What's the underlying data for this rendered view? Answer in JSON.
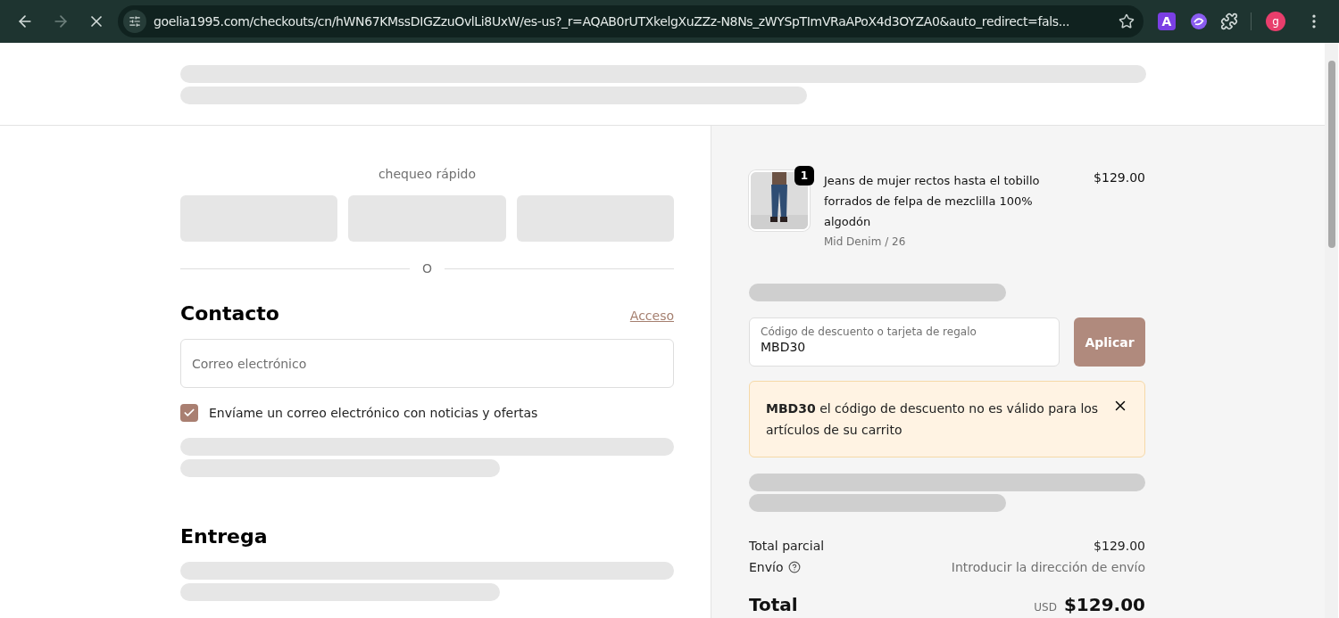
{
  "browser": {
    "url": "goelia1995.com/checkouts/cn/hWN67KMssDIGZzuOvlLi8UxW/es-us?_r=AQAB0rUTXkelgXuZZz-N8Ns_zWYSpTImVRaAPoX4d3OYZA0&auto_redirect=fals...",
    "loading": true,
    "extension_letter": "A",
    "profile_letter": "g"
  },
  "express": {
    "title": "chequeo rápido",
    "separator": "O"
  },
  "contact": {
    "heading": "Contacto",
    "login_link": "Acceso",
    "email": {
      "placeholder": "Correo electrónico"
    },
    "newsletter": {
      "label": "Envíame un correo electrónico con noticias y ofertas",
      "checked": true
    }
  },
  "delivery": {
    "heading": "Entrega"
  },
  "cart": {
    "items": [
      {
        "kind": "picture",
        "quantity": "1",
        "name": "Jeans de mujer rectos hasta el tobillo forrados de felpa de mezclilla 100% algodón",
        "variant": "Mid Denim / 26",
        "price": "$129.00"
      }
    ],
    "discount": {
      "label": "Código de descuento o tarjeta de regalo",
      "value": "MBD30",
      "button": "Aplicar"
    },
    "alert": {
      "text": "**MBD30** el código de descuento no es válido para los artículos de su carrito"
    },
    "subtotal": {
      "label": "Total parcial",
      "value": "$129.00"
    },
    "shipping": {
      "label": "Envío",
      "value": "Introducir la dirección de envío"
    },
    "total": {
      "label": "Total",
      "currency": "USD",
      "value": "$129.00"
    }
  }
}
